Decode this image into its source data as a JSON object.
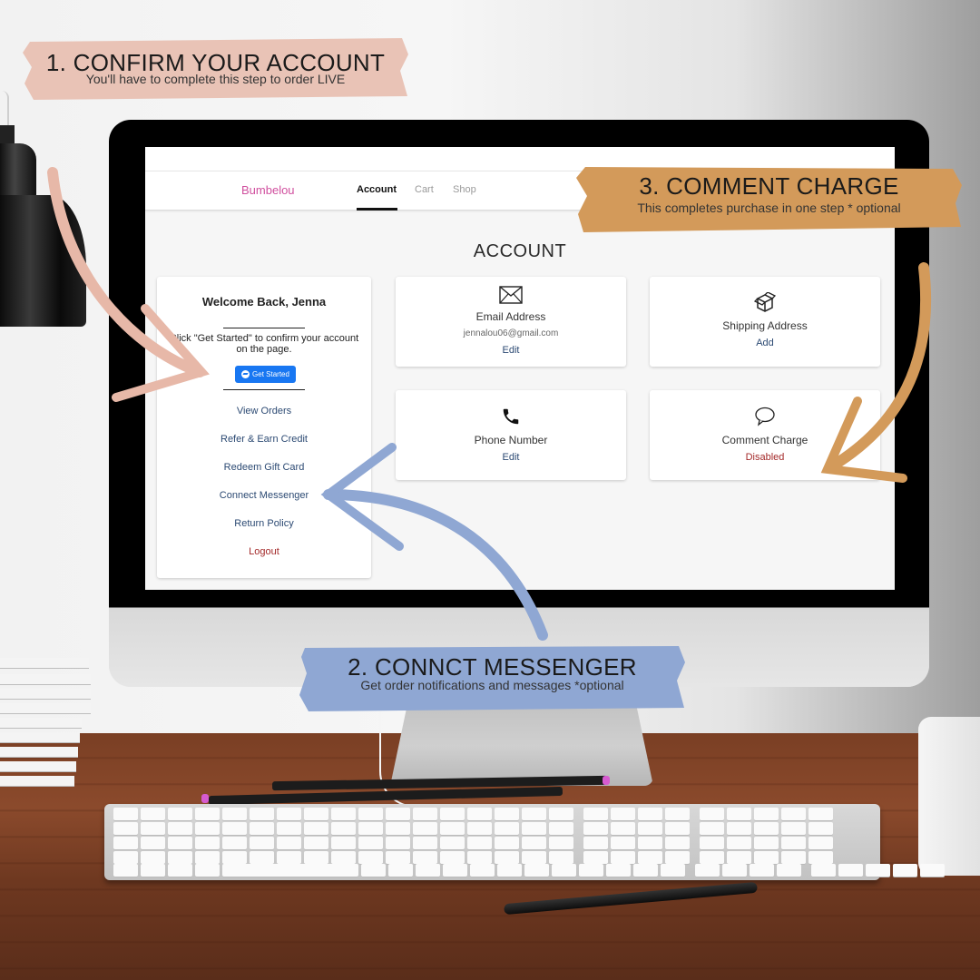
{
  "scene": {
    "callouts": [
      {
        "id": "step1",
        "title": "1. CONFIRM YOUR ACCOUNT",
        "subtitle": "You'll have to complete this step to order LIVE",
        "color": "#e9c3b6"
      },
      {
        "id": "step2",
        "title": "2. CONNCT MESSENGER",
        "subtitle": "Get order notifications and messages *optional",
        "color": "#8fa7d3"
      },
      {
        "id": "step3",
        "title": "3. COMMENT CHARGE",
        "subtitle": "This completes purchase in one step * optional",
        "color": "#d39a5a"
      }
    ]
  },
  "app": {
    "brand": "Bumbelou",
    "brand_color": "#d04f9e",
    "nav": [
      {
        "label": "Account",
        "active": true
      },
      {
        "label": "Cart",
        "active": false
      },
      {
        "label": "Shop",
        "active": false
      }
    ],
    "page_title": "ACCOUNT",
    "sidebar": {
      "welcome": "Welcome Back, Jenna",
      "instructions": "Click \"Get Started\" to confirm your account on the page.",
      "get_started_label": "Get Started",
      "get_started_icon": "messenger-icon",
      "links": [
        {
          "label": "View Orders"
        },
        {
          "label": "Refer & Earn Credit"
        },
        {
          "label": "Redeem Gift Card"
        },
        {
          "label": "Connect Messenger"
        },
        {
          "label": "Return Policy"
        },
        {
          "label": "Logout",
          "danger": true
        }
      ]
    },
    "cards": [
      {
        "icon": "envelope-icon",
        "title": "Email Address",
        "value": "jennalou06@gmail.com",
        "action": "Edit"
      },
      {
        "icon": "box-icon",
        "title": "Shipping Address",
        "value": "",
        "action": "Add"
      },
      {
        "icon": "phone-icon",
        "title": "Phone Number",
        "value": "",
        "action": "Edit"
      },
      {
        "icon": "speech-bubble-icon",
        "title": "Comment Charge",
        "value": "",
        "action": "Disabled",
        "status_color": "#a42a2a"
      }
    ],
    "link_color": "#2c4a73",
    "button_color": "#1877f2"
  }
}
